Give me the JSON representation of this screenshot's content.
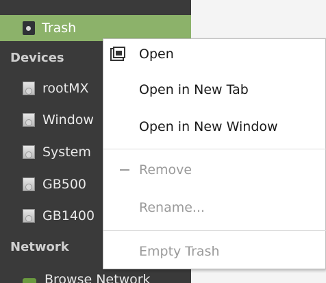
{
  "sidebar": {
    "trash_label": "Trash",
    "devices_heading": "Devices",
    "devices": [
      "rootMX",
      "Window",
      "System",
      "GB500",
      "GB1400"
    ],
    "network_heading": "Network",
    "browse_network_label": "Browse Network"
  },
  "context_menu": {
    "open": "Open",
    "open_new_tab": "Open in New Tab",
    "open_new_window": "Open in New Window",
    "remove": "Remove",
    "rename": "Rename...",
    "empty_trash": "Empty Trash"
  },
  "colors": {
    "sidebar_bg": "#3a3a3a",
    "selection": "#8cb26a",
    "menu_bg": "#ffffff",
    "disabled_text": "#9a9a9a"
  }
}
